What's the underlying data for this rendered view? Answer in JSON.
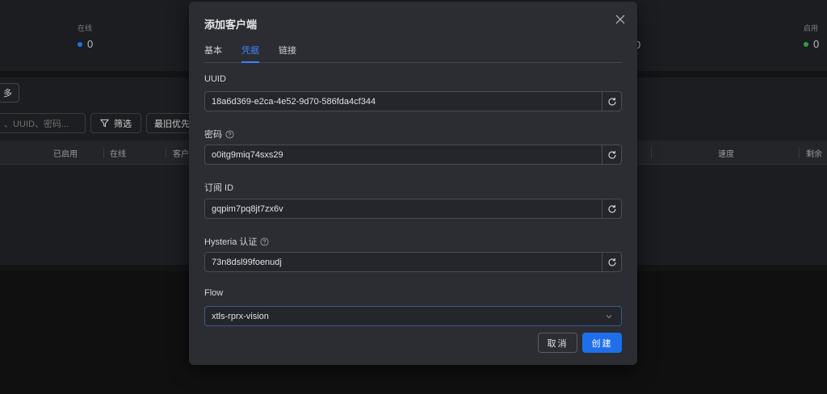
{
  "background": {
    "stats": [
      {
        "label": "在线",
        "value": "0",
        "dot_color": "#1f6feb"
      },
      {
        "label": "启用",
        "value": "0",
        "dot_color": "#2ea043"
      }
    ],
    "partial_stat_value": "0",
    "more_label": "多",
    "search_placeholder": "、UUID、密码...",
    "filter_label": "筛选",
    "sort_label": "最旧优先",
    "table_headers": [
      "已启用",
      "在线",
      "客户",
      "速度",
      "剩余"
    ]
  },
  "modal": {
    "title": "添加客户端",
    "tabs": [
      {
        "label": "基本",
        "active": false
      },
      {
        "label": "凭据",
        "active": true
      },
      {
        "label": "链接",
        "active": false
      }
    ],
    "fields": [
      {
        "label": "UUID",
        "value": "18a6d369-e2ca-4e52-9d70-586fda4cf344",
        "help": false
      },
      {
        "label": "密码",
        "value": "o0itg9miq74sxs29",
        "help": true
      },
      {
        "label": "订阅 ID",
        "value": "gqpim7pq8jt7zx6v",
        "help": false
      },
      {
        "label": "Hysteria 认证",
        "value": "73n8dsl99foenudj",
        "help": true
      }
    ],
    "flow": {
      "label": "Flow",
      "selected": "xtls-rprx-vision"
    },
    "cancel_label": "取消",
    "create_label": "创建"
  },
  "colors": {
    "accent": "#1f6feb",
    "tab_active": "#3c82f6",
    "modal_bg": "#2b2d33"
  }
}
